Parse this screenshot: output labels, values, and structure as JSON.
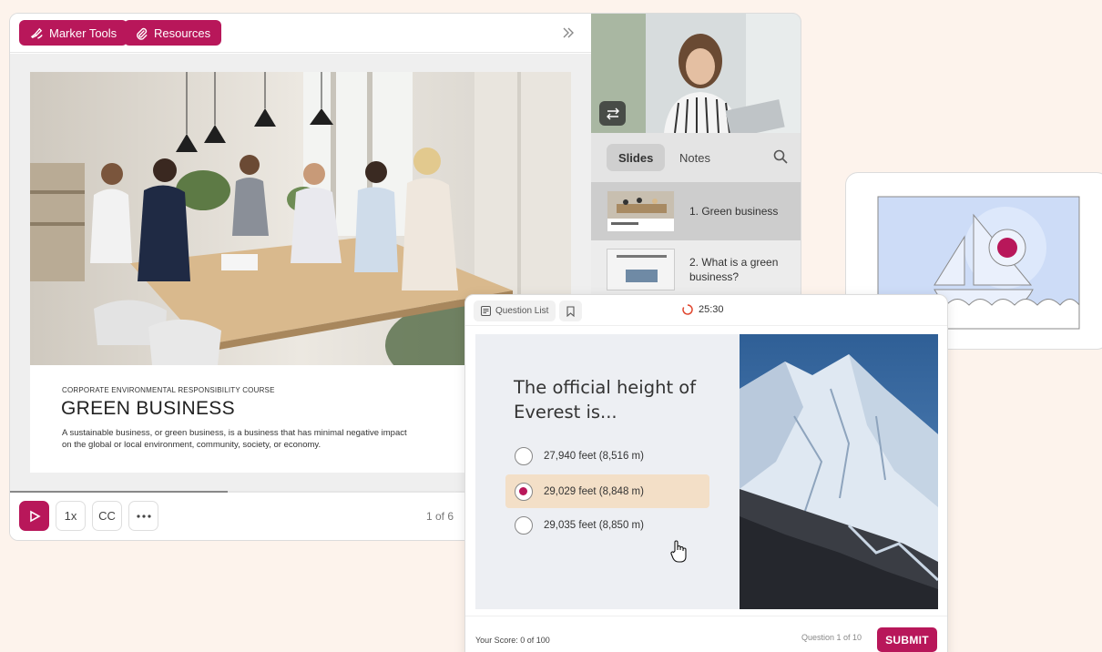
{
  "toolbar": {
    "marker_tools": "Marker Tools",
    "resources": "Resources"
  },
  "slide": {
    "kicker": "CORPORATE ENVIRONMENTAL RESPONSIBILITY COURSE",
    "title": "GREEN BUSINESS",
    "body": "A sustainable business, or green business, is a business that has minimal negative impact on the global or local environment, community, society, or economy."
  },
  "playback": {
    "speed": "1x",
    "captions": "CC",
    "page": "1 of 6",
    "progress": 0.375
  },
  "sidebar": {
    "tabs": [
      "Slides",
      "Notes"
    ],
    "items": [
      {
        "label": "1. Green business"
      },
      {
        "label": "2. What is a green business?"
      }
    ]
  },
  "quiz": {
    "question_list": "Question List",
    "timer": "25:30",
    "question": "The official height of Everest is...",
    "options": [
      {
        "label": "27,940 feet (8,516 m)",
        "selected": false
      },
      {
        "label": "29,029 feet (8,848 m)",
        "selected": true
      },
      {
        "label": "29,035 feet (8,850 m)",
        "selected": false
      }
    ],
    "score": "Your Score: 0 of 100",
    "question_count": "Question 1 of 10",
    "submit": "SUBMIT"
  },
  "colors": {
    "accent": "#b8175a",
    "background": "#fdf3ec",
    "selected_option": "#f3dfc7"
  },
  "icons": [
    "marker-icon",
    "paperclip-icon",
    "collapse-icon",
    "swap-icon",
    "search-icon",
    "play-icon",
    "more-icon",
    "list-icon",
    "bookmark-icon",
    "timer-icon",
    "hand-cursor-icon",
    "image-placeholder-icon"
  ]
}
